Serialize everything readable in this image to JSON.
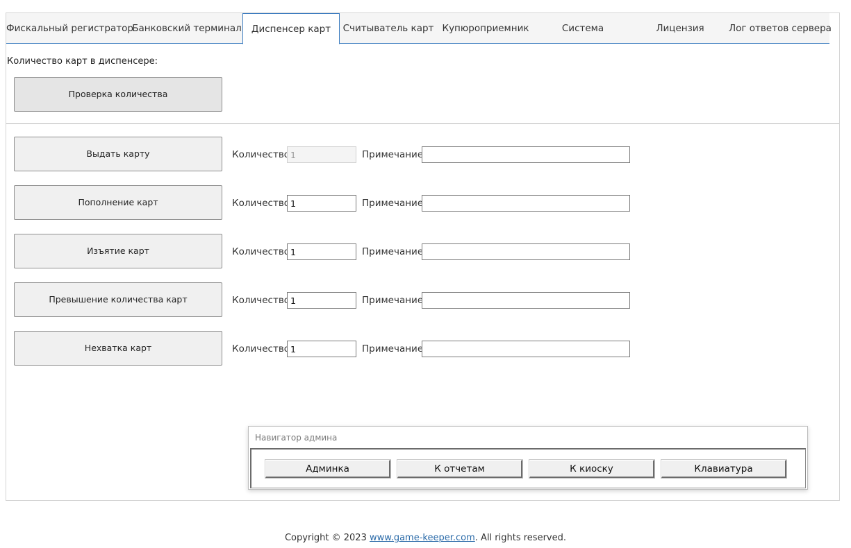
{
  "tabs": [
    {
      "label": "Фискальный регистратор"
    },
    {
      "label": "Банковский терминал"
    },
    {
      "label": "Диспенсер карт",
      "active": true
    },
    {
      "label": "Считыватель карт"
    },
    {
      "label": "Купюроприемник"
    },
    {
      "label": "Система"
    },
    {
      "label": "Лицензия"
    },
    {
      "label": "Лог ответов сервера"
    }
  ],
  "dispenser": {
    "count_label": "Количество карт в диспенсере:",
    "check_button": "Проверка количества"
  },
  "field_labels": {
    "quantity": "Количество",
    "note": "Примечание"
  },
  "actions": [
    {
      "button": "Выдать карту",
      "quantity": "1",
      "note": "",
      "quantity_disabled": true
    },
    {
      "button": "Пополнение карт",
      "quantity": "1",
      "note": ""
    },
    {
      "button": "Изъятие карт",
      "quantity": "1",
      "note": ""
    },
    {
      "button": "Превышение количества карт",
      "quantity": "1",
      "note": ""
    },
    {
      "button": "Нехватка карт",
      "quantity": "1",
      "note": ""
    }
  ],
  "navigator": {
    "title": "Навигатор админа",
    "buttons": [
      "Админка",
      "К отчетам",
      "К киоску",
      "Клавиатура"
    ]
  },
  "footer": {
    "prefix": "Copyright © 2023 ",
    "link": "www.game-keeper.com",
    "suffix": ". All rights reserved."
  }
}
